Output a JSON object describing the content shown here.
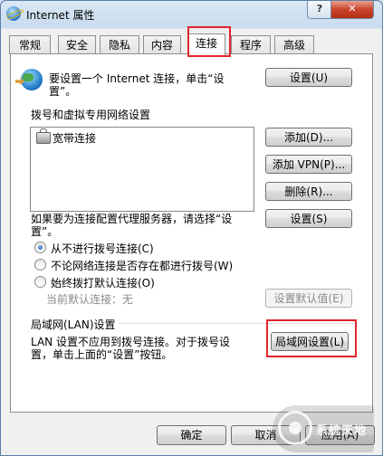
{
  "window": {
    "title": "Internet 属性",
    "help_label": "?",
    "close_label": "✕"
  },
  "tabs": [
    {
      "label": "常规"
    },
    {
      "label": "安全"
    },
    {
      "label": "隐私"
    },
    {
      "label": "内容"
    },
    {
      "label": "连接",
      "active": true
    },
    {
      "label": "程序"
    },
    {
      "label": "高级"
    }
  ],
  "setup": {
    "text_line1": "要设置一个 Internet 连接，单击“设",
    "text_line2": "置”。",
    "button": "设置(U)"
  },
  "dialup": {
    "heading": "拨号和虚拟专用网络设置",
    "connections": [
      "宽带连接"
    ],
    "add_button": "添加(D)...",
    "add_vpn_button": "添加 VPN(P)...",
    "delete_button": "删除(R)...",
    "proxy_text_line1": "如果要为连接配置代理服务器，请选择“设",
    "proxy_text_line2": "置”。",
    "settings_button": "设置(S)",
    "options": [
      {
        "label": "从不进行拨号连接(C)",
        "checked": true
      },
      {
        "label": "不论网络连接是否存在都进行拨号(W)",
        "checked": false
      },
      {
        "label": "始终拨打默认连接(O)",
        "checked": false
      }
    ],
    "current_default": "当前默认连接：无",
    "set_default_button": "设置默认值(E)"
  },
  "lan": {
    "heading": "局域网(LAN)设置",
    "text_line1": "LAN 设置不应用到拨号连接。对于拨号设",
    "text_line2": "置，单击上面的“设置”按钮。",
    "button": "局域网设置(L)"
  },
  "footer": {
    "ok": "确定",
    "cancel": "取消",
    "apply": "应用(A)"
  },
  "watermark": {
    "text": "系统天地"
  },
  "colors": {
    "highlight": "#e2252b",
    "title_gradient": "#c8dbee",
    "close_red": "#c8452c"
  }
}
